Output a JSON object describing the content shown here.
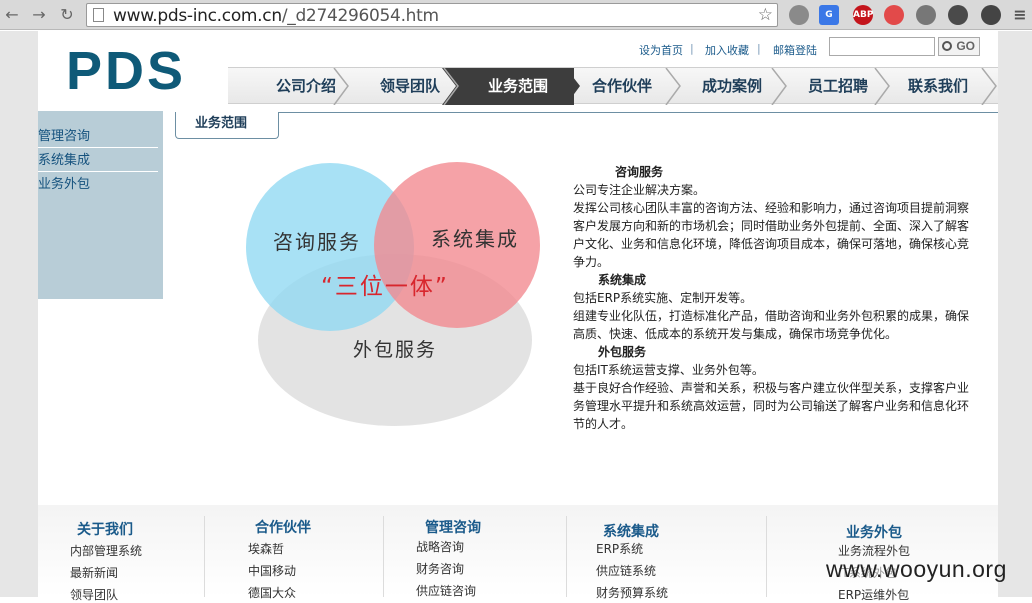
{
  "browser": {
    "url_host": "www.pds-inc.com.cn",
    "url_path": "/_d274296054.htm",
    "ext_abp": "ABP"
  },
  "logo": "PDS",
  "toplinks": [
    "设为首页",
    "加入收藏",
    "邮箱登陆"
  ],
  "search": {
    "go_label": "GO"
  },
  "nav": [
    "公司介绍",
    "领导团队",
    "业务范围",
    "合作伙伴",
    "成功案例",
    "员工招聘",
    "联系我们"
  ],
  "nav_active_index": 2,
  "sidebar": [
    "管理咨询",
    "系统集成",
    "业务外包"
  ],
  "content_tab": "业务范围",
  "diagram": {
    "left": "咨询服务",
    "right": "系统集成",
    "bottom": "外包服务",
    "center": "“三位一体”",
    "colors": {
      "left": "#8fd8f2",
      "right": "#f2888e",
      "bottom": "#dcdcdc",
      "center_text": "#d8262d"
    }
  },
  "services": [
    {
      "heading": "咨询服务",
      "lines": [
        "公司专注企业解决方案。",
        "发挥公司核心团队丰富的咨询方法、经验和影响力，通过咨询项目提前洞察",
        "客户发展方向和新的市场机会；同时借助业务外包提前、全面、深入了解客",
        "户文化、业务和信息化环境，降低咨询项目成本，确保可落地，确保核心竞",
        "争力。"
      ]
    },
    {
      "heading": "系统集成",
      "lines": [
        "包括ERP系统实施、定制开发等。",
        "组建专业化队伍，打造标准化产品，借助咨询和业务外包积累的成果，确保",
        "高质、快速、低成本的系统开发与集成，确保市场竞争优化。"
      ]
    },
    {
      "heading": "外包服务",
      "lines": [
        "包括IT系统运营支撑、业务外包等。",
        "基于良好合作经验、声誉和关系，积极与客户建立伙伴型关系，支撑客户业",
        "务管理水平提升和系统高效运营，同时为公司输送了解客户业务和信息化环",
        "节的人才。"
      ]
    }
  ],
  "footer": [
    {
      "title": "关于我们",
      "items": [
        "内部管理系统",
        "最新新闻",
        "领导团队"
      ]
    },
    {
      "title": "合作伙伴",
      "items": [
        "埃森哲",
        "中国移动",
        "德国大众"
      ]
    },
    {
      "title": "管理咨询",
      "items": [
        "战略咨询",
        "财务咨询",
        "供应链咨询"
      ]
    },
    {
      "title": "系统集成",
      "items": [
        "ERP系统",
        "供应链系统",
        "财务预算系统"
      ]
    },
    {
      "title": "业务外包",
      "items": [
        "业务流程外包",
        "IT系统外包",
        "ERP运维外包"
      ]
    }
  ],
  "watermark": "www.wooyun.org"
}
